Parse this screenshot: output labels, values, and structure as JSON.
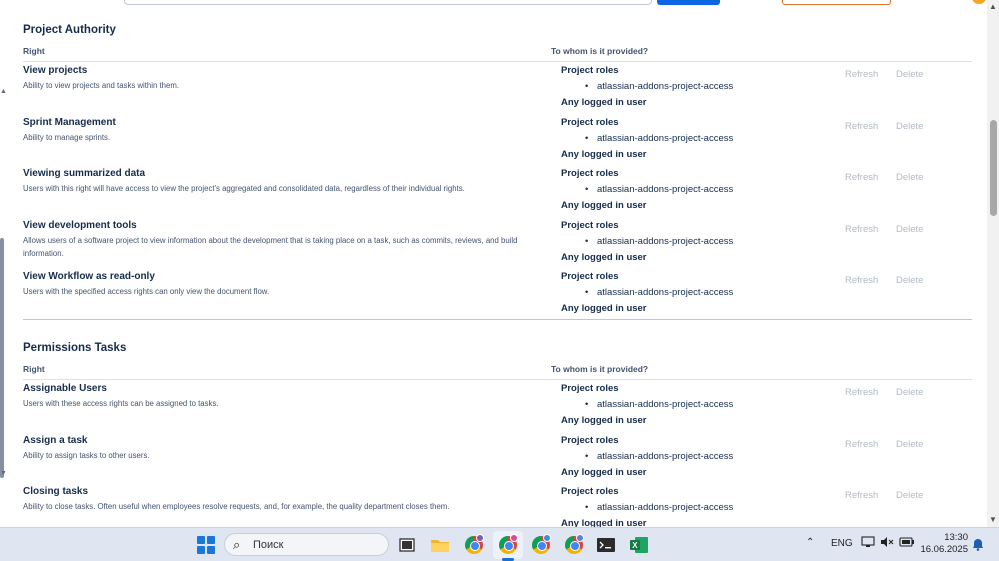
{
  "sections": [
    {
      "title": "Project Authority",
      "col_right": "Right",
      "col_whom": "To whom is it provided?",
      "rows": [
        {
          "name": "View projects",
          "desc": "Ability to view projects and tasks within them.",
          "roles_label": "Project roles",
          "role": "atlassian-addons-project-access",
          "any": "Any logged in user",
          "refresh": "Refresh",
          "delete": "Delete"
        },
        {
          "name": "Sprint Management",
          "desc": "Ability to manage sprints.",
          "roles_label": "Project roles",
          "role": "atlassian-addons-project-access",
          "any": "Any logged in user",
          "refresh": "Refresh",
          "delete": "Delete"
        },
        {
          "name": "Viewing summarized data",
          "desc": "Users with this right will have access to view the project's aggregated and consolidated data, regardless of their individual rights.",
          "roles_label": "Project roles",
          "role": "atlassian-addons-project-access",
          "any": "Any logged in user",
          "refresh": "Refresh",
          "delete": "Delete"
        },
        {
          "name": "View development tools",
          "desc": "Allows users of a software project to view information about the development that is taking place on a task, such as commits, reviews, and build information.",
          "roles_label": "Project roles",
          "role": "atlassian-addons-project-access",
          "any": "Any logged in user",
          "refresh": "Refresh",
          "delete": "Delete"
        },
        {
          "name": "View Workflow as read-only",
          "desc": "Users with the specified access rights can only view the document flow.",
          "roles_label": "Project roles",
          "role": "atlassian-addons-project-access",
          "any": "Any logged in user",
          "refresh": "Refresh",
          "delete": "Delete"
        }
      ]
    },
    {
      "title": "Permissions Tasks",
      "col_right": "Right",
      "col_whom": "To whom is it provided?",
      "rows": [
        {
          "name": "Assignable Users",
          "desc": "Users with these access rights can be assigned to tasks.",
          "roles_label": "Project roles",
          "role": "atlassian-addons-project-access",
          "any": "Any logged in user",
          "refresh": "Refresh",
          "delete": "Delete"
        },
        {
          "name": "Assign a task",
          "desc": "Ability to assign tasks to other users.",
          "roles_label": "Project roles",
          "role": "atlassian-addons-project-access",
          "any": "Any logged in user",
          "refresh": "Refresh",
          "delete": "Delete"
        },
        {
          "name": "Closing tasks",
          "desc": "Ability to close tasks. Often useful when employees resolve requests, and, for example, the quality department closes them.",
          "roles_label": "Project roles",
          "role": "atlassian-addons-project-access",
          "any": "Any logged in user",
          "refresh": "Refresh",
          "delete": "Delete"
        }
      ]
    }
  ],
  "taskbar": {
    "search_placeholder": "Поиск",
    "language": "ENG",
    "time": "13:30",
    "date": "16.06.2025",
    "icons": [
      "start-windows-icon",
      "search-icon",
      "task-view-icon",
      "file-explorer-icon",
      "chrome-icon",
      "chrome-icon",
      "chrome-icon",
      "chrome-icon",
      "terminal-icon",
      "excel-icon"
    ],
    "tray_icons": [
      "chevron-up-icon",
      "network-icon",
      "speaker-muted-icon",
      "battery-icon",
      "notification-bell-icon"
    ]
  },
  "colors": {
    "accent": "#0c66e4",
    "text": "#172b4d",
    "muted": "#44546f",
    "disabled": "#b3b9c4",
    "taskbar": "#dfe6f1"
  }
}
